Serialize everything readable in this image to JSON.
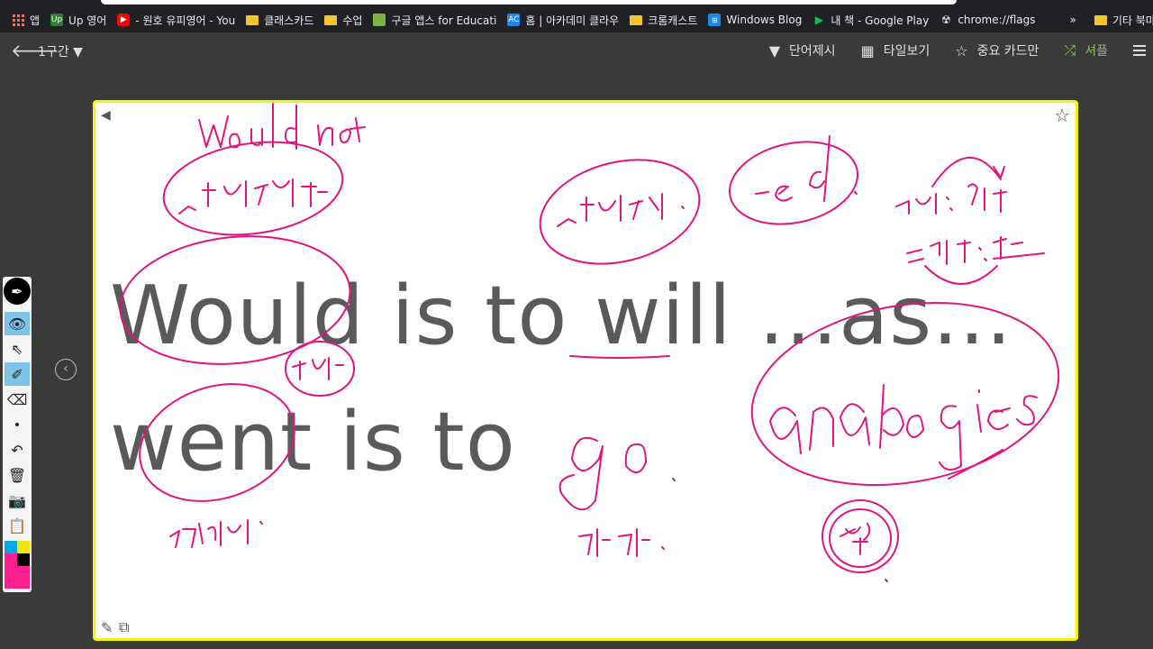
{
  "bookmarks": [
    {
      "label": "앱",
      "icon": "apps-grid-icon"
    },
    {
      "label": "Up 영어",
      "icon": "green-tile-icon",
      "color": "#2e7d32"
    },
    {
      "label": "- 원호 유피영어 - You",
      "icon": "youtube-icon",
      "color": "#ff0000"
    },
    {
      "label": "클래스카드",
      "icon": "folder-icon"
    },
    {
      "label": "수업",
      "icon": "folder-icon"
    },
    {
      "label": "구글 앱스 for Educati",
      "icon": "green-book-icon",
      "color": "#7cb342"
    },
    {
      "label": "홈 | 아카데미 클라우",
      "icon": "ac-icon",
      "color": "#1e88e5"
    },
    {
      "label": "크롬캐스트",
      "icon": "folder-icon"
    },
    {
      "label": "Windows Blog",
      "icon": "windows-icon",
      "color": "#1e88e5"
    },
    {
      "label": "내 책 - Google Play",
      "icon": "play-icon",
      "color": "#ffffff"
    },
    {
      "label": "chrome://flags",
      "icon": "flags-icon",
      "color": "#dddddd"
    },
    {
      "label": "»",
      "icon": ""
    },
    {
      "label": "기타 북마크",
      "icon": "folder-icon"
    }
  ],
  "app_bar": {
    "section": "1구간 ▼",
    "tools": [
      {
        "label": "단어제시",
        "icon": "triangle-down-icon",
        "glyph": "▼"
      },
      {
        "label": "타일보기",
        "icon": "grid-icon",
        "glyph": "▦"
      },
      {
        "label": "중요 카드만",
        "icon": "star-outline-icon",
        "glyph": "☆"
      },
      {
        "label": "셔플",
        "icon": "shuffle-icon",
        "glyph": "⤮",
        "color": "#8bc34a"
      }
    ]
  },
  "card": {
    "line1": "Would is to will ...as...",
    "line2": "went is to",
    "border_color": "#f5f500",
    "ink_color": "#e0157f"
  },
  "tool_panel": {
    "swatch_colors": [
      "#00a8e8",
      "#f5e600",
      "#ff1f8e",
      "#000000",
      "#ff1f8e"
    ]
  }
}
